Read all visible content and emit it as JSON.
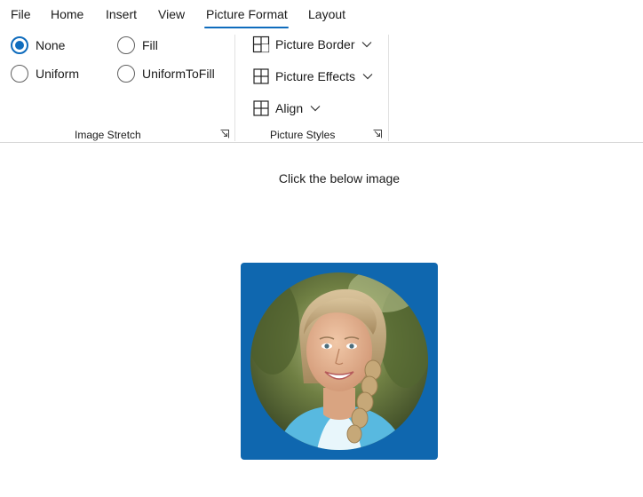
{
  "tabs": {
    "file": "File",
    "home": "Home",
    "insert": "Insert",
    "view": "View",
    "picture_format": "Picture Format",
    "layout": "Layout",
    "selected": "Picture Format"
  },
  "image_stretch": {
    "label": "Image Stretch",
    "selected": "None",
    "options": {
      "none": "None",
      "fill": "Fill",
      "uniform": "Uniform",
      "uniform_to_fill": "UniformToFill"
    }
  },
  "picture_styles": {
    "label": "Picture Styles",
    "border": "Picture Border",
    "effects": "Picture Effects",
    "align": "Align"
  },
  "content": {
    "instruction": "Click the below image"
  },
  "colors": {
    "accent": "#0f6cbd",
    "frame_fill": "#0f67af"
  },
  "icons": {
    "dialog_launcher": "dialog-launcher-icon",
    "border": "picture-border-icon",
    "effects": "picture-effects-icon",
    "align": "align-icon",
    "chevron": "chevron-down-icon"
  }
}
